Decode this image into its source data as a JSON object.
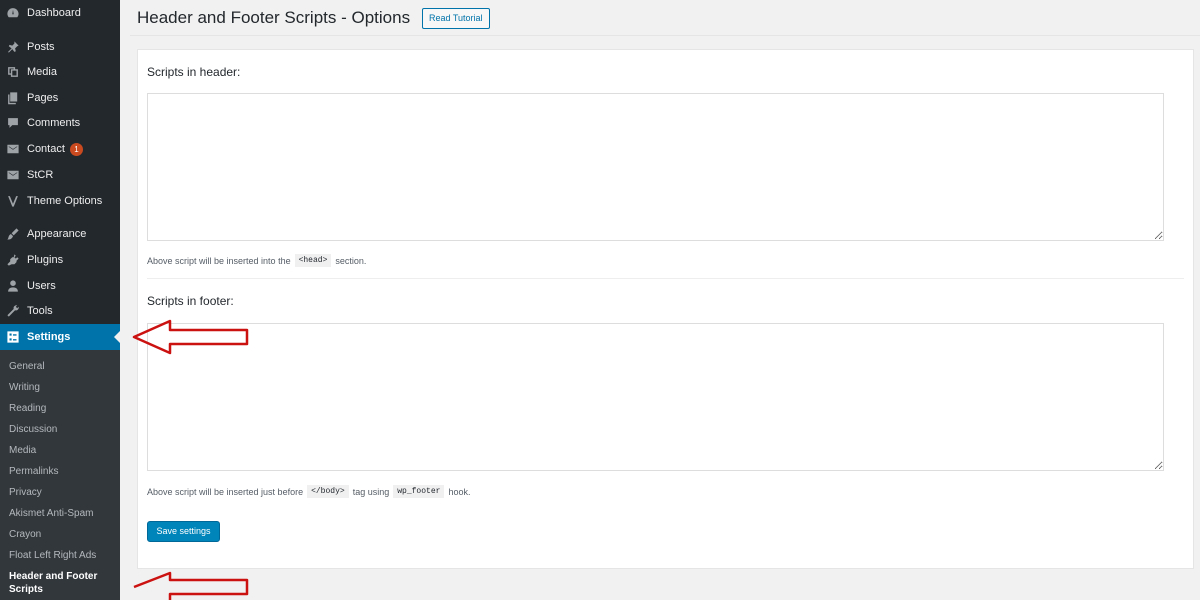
{
  "sidebar": {
    "items": [
      {
        "label": "Dashboard",
        "icon": "dashboard-icon"
      },
      {
        "label": "Posts",
        "icon": "pin-icon"
      },
      {
        "label": "Media",
        "icon": "media-icon"
      },
      {
        "label": "Pages",
        "icon": "pages-icon"
      },
      {
        "label": "Comments",
        "icon": "comment-icon"
      },
      {
        "label": "Contact",
        "icon": "mail-icon",
        "badge": "1"
      },
      {
        "label": "StCR",
        "icon": "mail-icon"
      },
      {
        "label": "Theme Options",
        "icon": "v-icon"
      },
      {
        "label": "Appearance",
        "icon": "brush-icon"
      },
      {
        "label": "Plugins",
        "icon": "plugin-icon"
      },
      {
        "label": "Users",
        "icon": "user-icon"
      },
      {
        "label": "Tools",
        "icon": "wrench-icon"
      },
      {
        "label": "Settings",
        "icon": "settings-icon"
      }
    ],
    "submenu": [
      "General",
      "Writing",
      "Reading",
      "Discussion",
      "Media",
      "Permalinks",
      "Privacy",
      "Akismet Anti-Spam",
      "Crayon",
      "Float Left Right Ads",
      "Header and Footer Scripts"
    ]
  },
  "header": {
    "title": "Header and Footer Scripts - Options",
    "tutorial_label": "Read Tutorial"
  },
  "main": {
    "header_section": {
      "title": "Scripts in header:",
      "value": "",
      "desc_before": "Above script will be inserted into the",
      "desc_code": "<head>",
      "desc_after": "section."
    },
    "footer_section": {
      "title": "Scripts in footer:",
      "value": "",
      "desc_before": "Above script will be inserted just before",
      "desc_code1": "</body>",
      "desc_middle": "tag using",
      "desc_code2": "wp_footer",
      "desc_after": "hook."
    },
    "save_label": "Save settings"
  },
  "colors": {
    "sidebar_bg": "#23282d",
    "submenu_bg": "#32373c",
    "accent": "#0073aa",
    "badge": "#ca4a1f",
    "arrow": "#cc1111"
  }
}
